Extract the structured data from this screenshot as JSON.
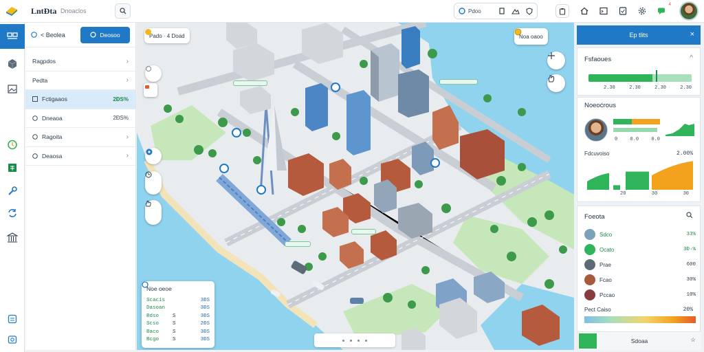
{
  "app": {
    "title": "LntĐta",
    "subtitle": "Dnoaclos"
  },
  "toolbar": {
    "group": [
      {
        "icon": "globe-icon",
        "label": "Pdoo"
      },
      {
        "icon": "building-icon",
        "label": ""
      },
      {
        "icon": "chart-icon",
        "label": ""
      },
      {
        "icon": "shield-icon",
        "label": ""
      }
    ],
    "notification_count": "4"
  },
  "side": {
    "back_label": "< Beolea",
    "primary_label": "Deosoo",
    "items": [
      {
        "label": "Ragpdos",
        "value": "",
        "icon": "chevron"
      },
      {
        "label": "Pedta",
        "value": "",
        "icon": "chevron"
      },
      {
        "label": "Fctigaaos",
        "value": "2ĐS%",
        "active": true
      },
      {
        "label": "Dneaoa",
        "value": "2ĐS%"
      },
      {
        "label": "Ragoita",
        "value": "",
        "icon": "chevron"
      },
      {
        "label": "Deaosa",
        "value": "",
        "icon": "chevron"
      }
    ]
  },
  "map": {
    "top_chip": "Pado · 4 Doad",
    "right_chip": "Noa oaoo",
    "legend_title": "Noe oeoe",
    "legend_rows": [
      {
        "a": "Scacis",
        "b": "",
        "c": "3ĐS"
      },
      {
        "a": "Dasoan",
        "b": "",
        "c": "3ĐS"
      },
      {
        "a": "Bdso",
        "b": "S",
        "c": "3ĐS"
      },
      {
        "a": "Scso",
        "b": "S",
        "c": "2ĐS"
      },
      {
        "a": "Baco",
        "b": "S",
        "c": "3ĐS"
      },
      {
        "a": "Bcgo",
        "b": "S",
        "c": "3ĐS"
      }
    ]
  },
  "right": {
    "header": "Ep tlits",
    "panel1": {
      "title": "Fsfaoues",
      "axis": [
        "2.30",
        "2.30",
        "2.30",
        "2.30"
      ],
      "progress": 0.62
    },
    "panel2": {
      "title": "Noeoćrous",
      "mini_axis": [
        "0",
        "0.0",
        "0.0"
      ],
      "sub_title": "Fdcuvoiso",
      "sub_value": "2.00%",
      "chart_axis": [
        "20",
        "30",
        "30"
      ],
      "bars": [
        0.55,
        0.15,
        0.6,
        0.95
      ]
    },
    "panel3": {
      "title": "Foeota",
      "rows": [
        {
          "label": "Sdco",
          "value": "33%",
          "color": "#1b8a4a"
        },
        {
          "label": "Ocato",
          "value": "3Đ·%",
          "color": "#1b8a4a"
        },
        {
          "label": "Prae",
          "value": "600",
          "color": "#2b3a4a"
        },
        {
          "label": "Fcao",
          "value": "30%",
          "color": "#2b3a4a"
        },
        {
          "label": "Pccao",
          "value": "10%",
          "color": "#2b3a4a"
        }
      ],
      "footer_title": "Pect Caiso",
      "footer_value": "20%",
      "bottom_label": "Sdoaa"
    }
  },
  "colors": {
    "accent": "#1f79c6",
    "water": "#8fd3ee",
    "green": "#2fb45a",
    "orange": "#f3a21e"
  }
}
